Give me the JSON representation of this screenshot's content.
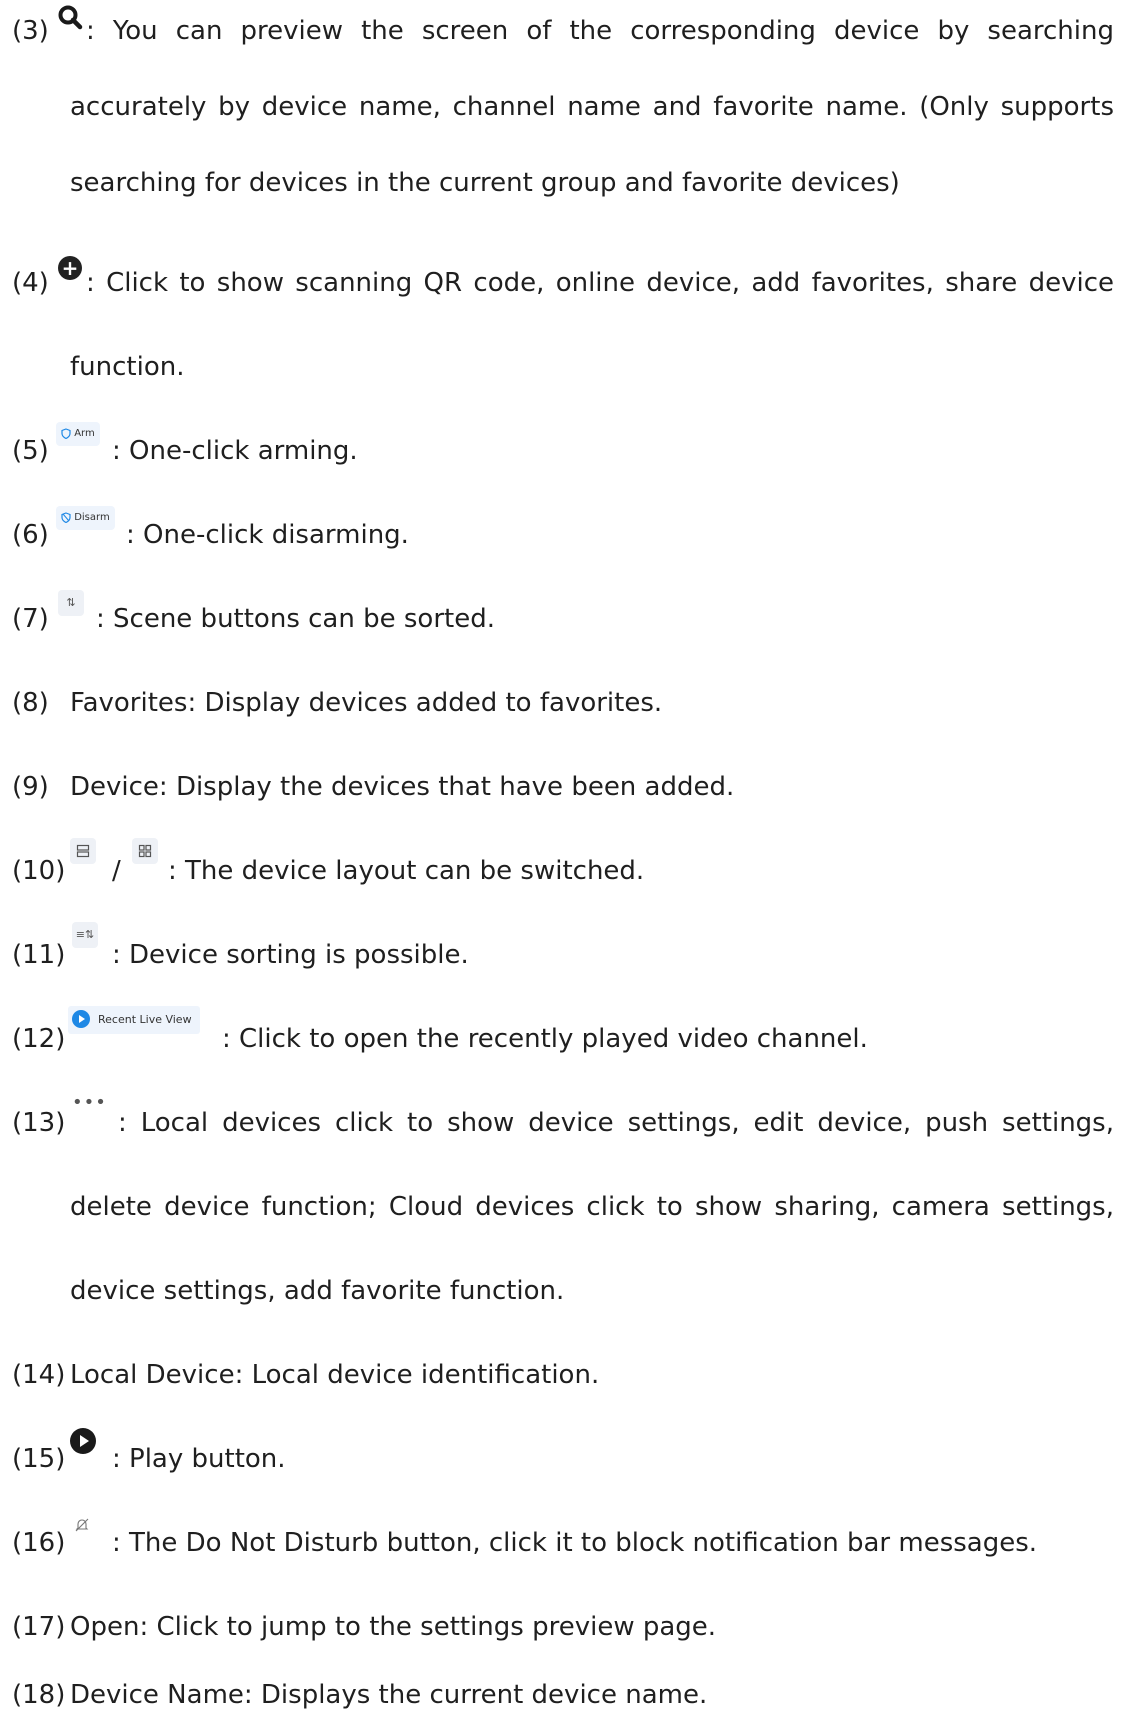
{
  "items": [
    {
      "num": "(3)",
      "icon": "search-icon",
      "lines": [
        " : You can preview the screen of the corresponding device by searching",
        "accurately by device name, channel name and favorite name. (Only supports",
        "searching for devices in the current group and favorite devices)"
      ]
    },
    {
      "num": "(4)",
      "icon": "add-circle-icon",
      "lines": [
        ": Click to show scanning QR code, online device, add favorites, share device",
        "function."
      ]
    },
    {
      "num": "(5)",
      "icon": "arm-shield-icon",
      "icon_text": "Arm",
      "lines": [
        ": One-click arming."
      ]
    },
    {
      "num": "(6)",
      "icon": "disarm-shield-icon",
      "icon_text": "Disarm",
      "lines": [
        ": One-click disarming."
      ]
    },
    {
      "num": "(7)",
      "icon": "sort-arrows-icon",
      "lines": [
        ": Scene buttons can be sorted."
      ]
    },
    {
      "num": "(8)",
      "lines": [
        "Favorites: Display devices added to favorites."
      ]
    },
    {
      "num": "(9)",
      "lines": [
        "Device: Display the devices that have been added."
      ]
    },
    {
      "num": "(10)",
      "icon": "list-layout-icon",
      "separator": "/",
      "icon2": "grid-layout-icon",
      "lines": [
        ": The device layout can be switched."
      ]
    },
    {
      "num": "(11)",
      "icon": "sort-list-icon",
      "lines": [
        ": Device sorting is possible."
      ]
    },
    {
      "num": "(12)",
      "icon": "recent-live-view-icon",
      "icon_text": "Recent Live View",
      "lines": [
        ": Click to open the recently played video channel."
      ]
    },
    {
      "num": "(13)",
      "icon": "more-dots-icon",
      "lines": [
        ": Local devices click to show device settings, edit device, push settings,",
        "delete device function; Cloud devices click to show sharing, camera settings,",
        "device settings, add favorite function."
      ]
    },
    {
      "num": "(14)",
      "lines": [
        "Local Device: Local device identification."
      ]
    },
    {
      "num": "(15)",
      "icon": "play-icon",
      "lines": [
        ": Play button."
      ]
    },
    {
      "num": "(16)",
      "icon": "do-not-disturb-bell-icon",
      "lines": [
        ": The Do Not Disturb button, click it to block notification bar messages."
      ]
    },
    {
      "num": "(17)",
      "lines": [
        "Open: Click to jump to the settings preview page."
      ]
    },
    {
      "num": "(18)",
      "lines": [
        "Device Name: Displays the current device name."
      ]
    }
  ]
}
